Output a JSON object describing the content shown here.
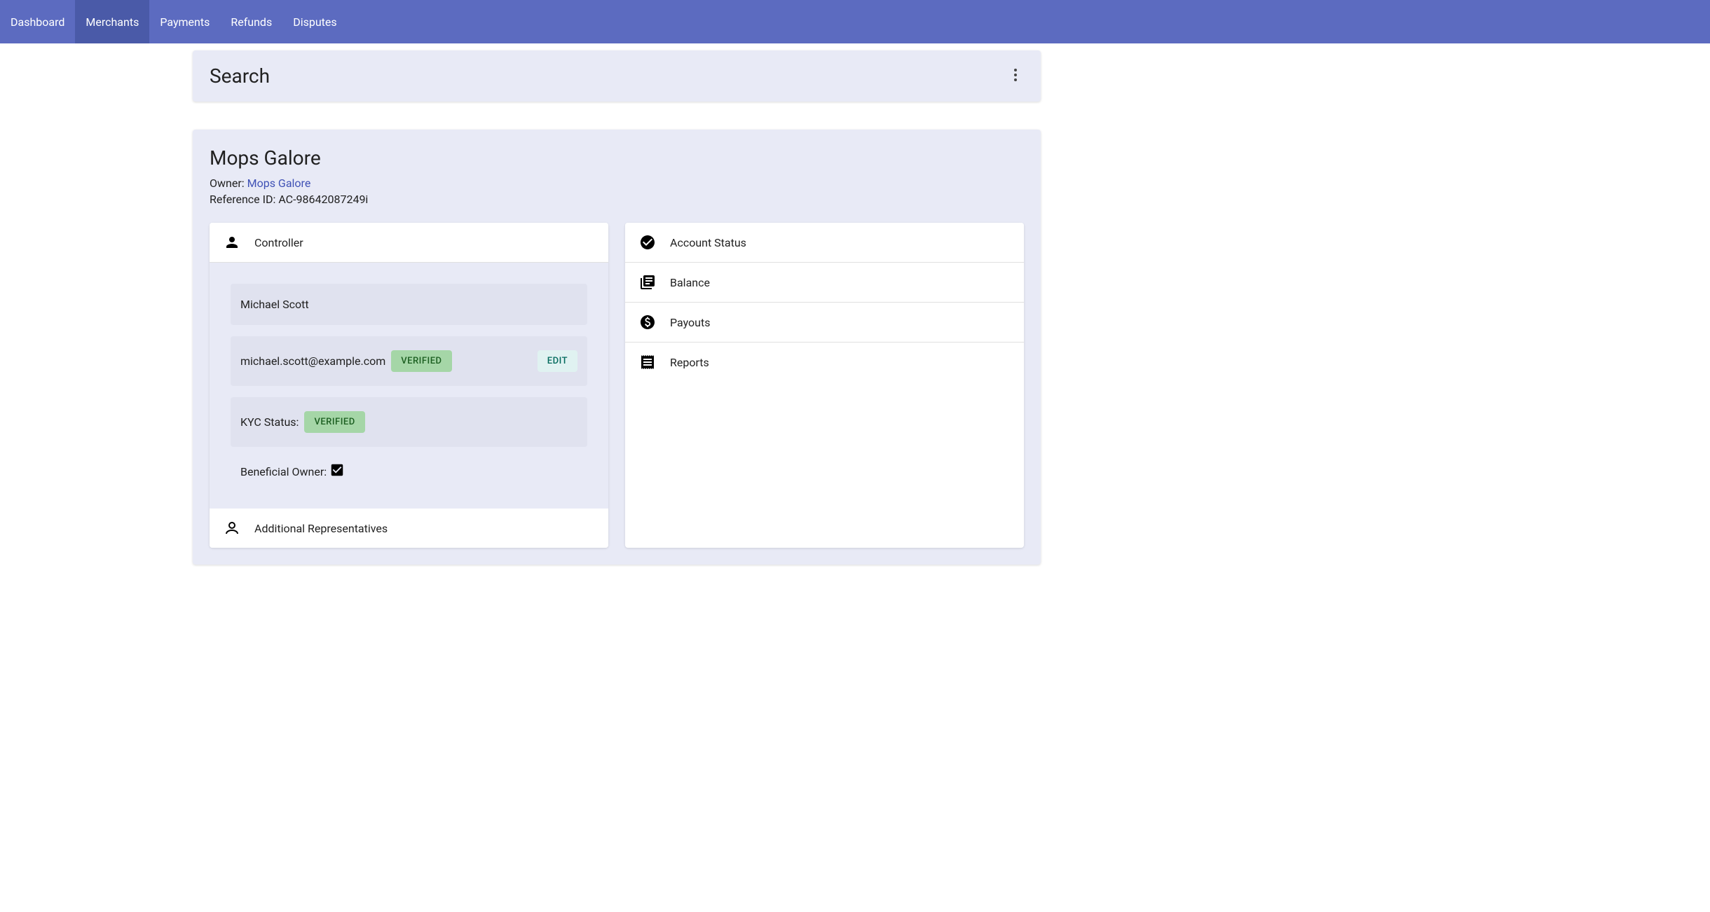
{
  "nav": {
    "items": [
      {
        "label": "Dashboard",
        "active": false
      },
      {
        "label": "Merchants",
        "active": true
      },
      {
        "label": "Payments",
        "active": false
      },
      {
        "label": "Refunds",
        "active": false
      },
      {
        "label": "Disputes",
        "active": false
      }
    ]
  },
  "search": {
    "title": "Search"
  },
  "merchant": {
    "name": "Mops Galore",
    "owner_label": "Owner:",
    "owner_link_text": "Mops Galore",
    "reference_label": "Reference ID:",
    "reference_id": "AC-98642087249i"
  },
  "controller_panel": {
    "header": "Controller",
    "name": "Michael Scott",
    "email": "michael.scott@example.com",
    "email_status": "VERIFIED",
    "edit_label": "EDIT",
    "kyc_label": "KYC Status:",
    "kyc_status": "VERIFIED",
    "beneficial_label": "Beneficial Owner:",
    "beneficial_checked": true
  },
  "additional_reps": {
    "header": "Additional Representatives"
  },
  "right_panel": {
    "items": [
      {
        "label": "Account Status",
        "icon": "check-circle"
      },
      {
        "label": "Balance",
        "icon": "library-books"
      },
      {
        "label": "Payouts",
        "icon": "paid"
      },
      {
        "label": "Reports",
        "icon": "receipt"
      }
    ]
  }
}
